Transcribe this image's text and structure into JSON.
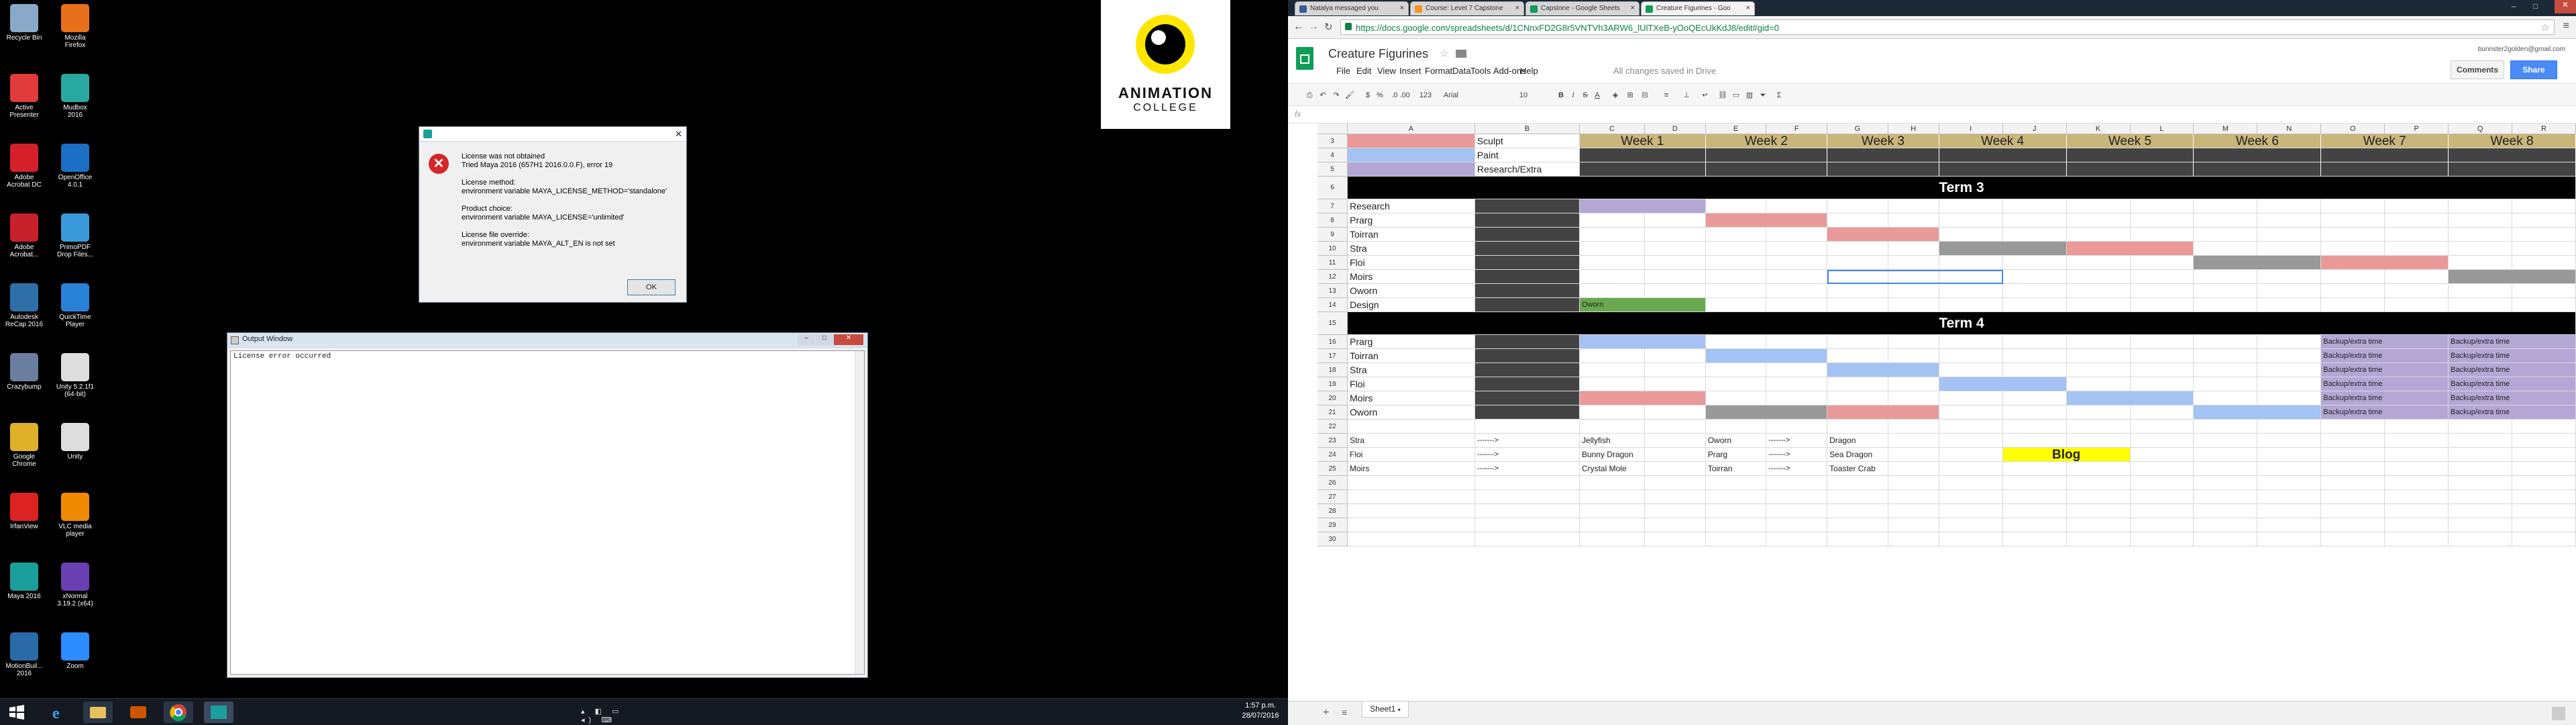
{
  "desktop": {
    "icons": [
      {
        "label": "Recycle Bin",
        "icon": "recycle-bin-icon",
        "color": "#8aa9c9"
      },
      {
        "label": "Mozilla Firefox",
        "icon": "firefox-icon",
        "color": "#e8701a"
      },
      {
        "label": "Active Presenter",
        "icon": "active-presenter-icon",
        "color": "#e23b3b"
      },
      {
        "label": "Mudbox 2016",
        "icon": "mudbox-icon",
        "color": "#2aa9a1"
      },
      {
        "label": "Adobe Acrobat DC",
        "icon": "acrobat-icon",
        "color": "#d4202a"
      },
      {
        "label": "OpenOffice 4.0.1",
        "icon": "openoffice-icon",
        "color": "#1b6fc4"
      },
      {
        "label": "Adobe Acrobat...",
        "icon": "acrobat-icon",
        "color": "#c8202a"
      },
      {
        "label": "PrimoPDF Drop Files...",
        "icon": "primopdf-icon",
        "color": "#3a9ad9"
      },
      {
        "label": "Autodesk ReCap 2016",
        "icon": "recap-icon",
        "color": "#2f6fa8"
      },
      {
        "label": "QuickTime Player",
        "icon": "quicktime-icon",
        "color": "#2a82d8"
      },
      {
        "label": "Crazybump",
        "icon": "crazybump-icon",
        "color": "#6a7fa0"
      },
      {
        "label": "Unity 5.2.1f1 (64-bit)",
        "icon": "unity-icon",
        "color": "#ddd"
      },
      {
        "label": "Google Chrome",
        "icon": "chrome-icon",
        "color": "#e0b02b"
      },
      {
        "label": "Unity",
        "icon": "unity-icon",
        "color": "#ddd"
      },
      {
        "label": "IrfanView",
        "icon": "irfanview-icon",
        "color": "#d22"
      },
      {
        "label": "VLC media player",
        "icon": "vlc-icon",
        "color": "#f08a00"
      },
      {
        "label": "Maya 2016",
        "icon": "maya-icon",
        "color": "#1a9f9a"
      },
      {
        "label": "xNormal 3.19.2 (x64)",
        "icon": "xnormal-icon",
        "color": "#6a3fb1"
      },
      {
        "label": "MotionBuil... 2016",
        "icon": "motionbuilder-icon",
        "color": "#2b6aa8"
      },
      {
        "label": "Zoom",
        "icon": "zoom-icon",
        "color": "#2d8cff"
      }
    ],
    "logo": {
      "line1": "ANIMATION",
      "line2": "COLLEGE"
    },
    "dialog": {
      "lines": [
        "License was not obtained",
        "Tried Maya 2016 (657H1 2016.0.0.F), error 19",
        "",
        "License method:",
        "environment variable MAYA_LICENSE_METHOD='standalone'",
        "",
        "Product choice:",
        "environment variable MAYA_LICENSE='unlimited'",
        "",
        "License file override:",
        "environment variable MAYA_ALT_EN is not set"
      ],
      "ok": "OK"
    },
    "output": {
      "title": "Output Window",
      "text": "License error occurred"
    },
    "clock": {
      "time": "1:57 p.m.",
      "date": "28/07/2016"
    }
  },
  "browser": {
    "tabs": [
      {
        "label": "Natalya messaged you",
        "color": "#3b5998"
      },
      {
        "label": "Course: Level 7 Capstone",
        "color": "#f7931e"
      },
      {
        "label": "Capstone - Google Sheets",
        "color": "#0f9d58"
      },
      {
        "label": "Creature Figurines - Goo",
        "color": "#0f9d58",
        "active": true
      }
    ],
    "url": "https://docs.google.com/spreadsheets/d/1CNnxFD2G8r5VNTVh3ARW6_lUlTXeB-yOoQEcUkKdJ8/edit#gid=0",
    "doc_title": "Creature Figurines",
    "user": "bunnster2golden@gmail.com",
    "comments": "Comments",
    "share": "Share",
    "menu": [
      "File",
      "Edit",
      "View",
      "Insert",
      "Format",
      "Data",
      "Tools",
      "Add-ons",
      "Help"
    ],
    "saved": "All changes saved in Drive",
    "toolbar": {
      "zoom": "123",
      "font": "Arial",
      "size": "10",
      "currency": "$",
      "percent": "%",
      "decimals": ".0 .00"
    },
    "fx": "fx",
    "sheet_tab": "Sheet1",
    "colors": {
      "red": "#ea9999",
      "blue": "#a4c2f4",
      "purple": "#b4a7d6",
      "gold": "#c9b67a",
      "dark": "#434343",
      "gray": "#999999",
      "green": "#6aa84f",
      "yellow": "#ffff00",
      "black": "#000000"
    }
  },
  "sheet": {
    "columns": [
      "A",
      "B",
      "C",
      "D",
      "E",
      "F",
      "G",
      "H",
      "I",
      "J",
      "K",
      "L",
      "M",
      "N",
      "O",
      "P",
      "Q",
      "R"
    ],
    "rows": [
      "3",
      "4",
      "5",
      "6",
      "7",
      "8",
      "9",
      "10",
      "11",
      "12",
      "13",
      "14",
      "15",
      "16",
      "17",
      "18",
      "19",
      "20",
      "21",
      "22",
      "23",
      "24",
      "25",
      "26",
      "27",
      "28",
      "29",
      "30"
    ],
    "legend": [
      "Sculpt",
      "Paint",
      "Research/Extra"
    ],
    "weeks": [
      "Week 1",
      "Week 2",
      "Week 3",
      "Week 4",
      "Week 5",
      "Week 6",
      "Week 7",
      "Week 8"
    ],
    "term3": "Term 3",
    "term4": "Term 4",
    "term3_tasks": [
      "Research",
      "Prarg",
      "Toirran",
      "Stra",
      "Floi",
      "Moirs",
      "Oworn",
      "Design"
    ],
    "term4_tasks": [
      "Prarg",
      "Toirran",
      "Stra",
      "Floi",
      "Moirs",
      "Oworn"
    ],
    "design_note": "Oworn",
    "backup": "Backup/extra time",
    "pairs": [
      {
        "a": "Stra",
        "arrow": "------->",
        "b": "Jellyfish",
        "c": "Oworn",
        "arrow2": "------->",
        "d": "Dragon"
      },
      {
        "a": "Floi",
        "arrow": "------->",
        "b": "Bunny Dragon",
        "c": "Prarg",
        "arrow2": "------->",
        "d": "Sea Dragon"
      },
      {
        "a": "Moirs",
        "arrow": "------->",
        "b": "Crystal Mole",
        "c": "Toirran",
        "arrow2": "------->",
        "d": "Toaster Crab"
      }
    ],
    "blog": "Blog"
  }
}
